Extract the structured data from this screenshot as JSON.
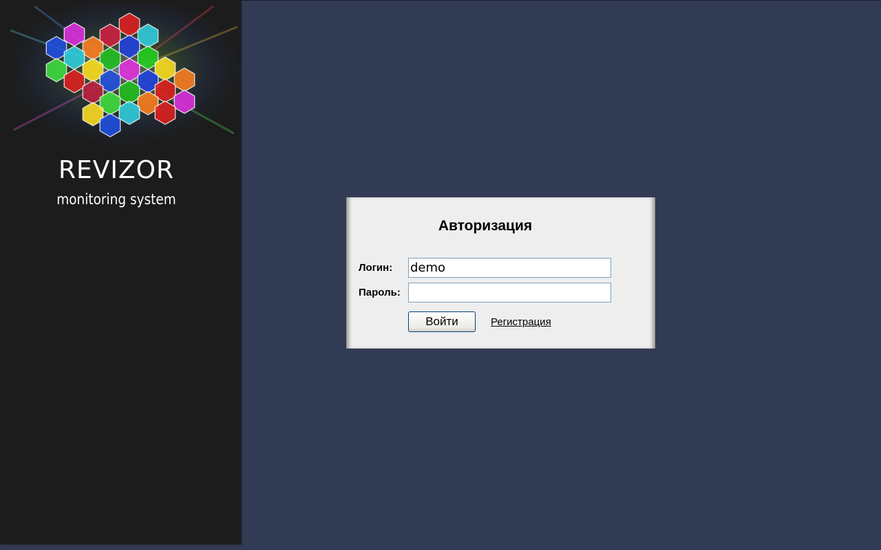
{
  "sidebar": {
    "logo_icon": "colorful-hexagon-cluster-icon",
    "brand_title": "REVIZOR",
    "brand_subtitle": "monitoring system"
  },
  "login": {
    "title": "Авторизация",
    "username_label": "Логин:",
    "username_value": "demo",
    "password_label": "Пароль:",
    "password_value": "",
    "submit_label": "Войти",
    "register_label": "Регистрация"
  },
  "colors": {
    "page_background": "#323b54",
    "sidebar_background": "#1c1c1c",
    "panel_background": "#eeeeee"
  }
}
